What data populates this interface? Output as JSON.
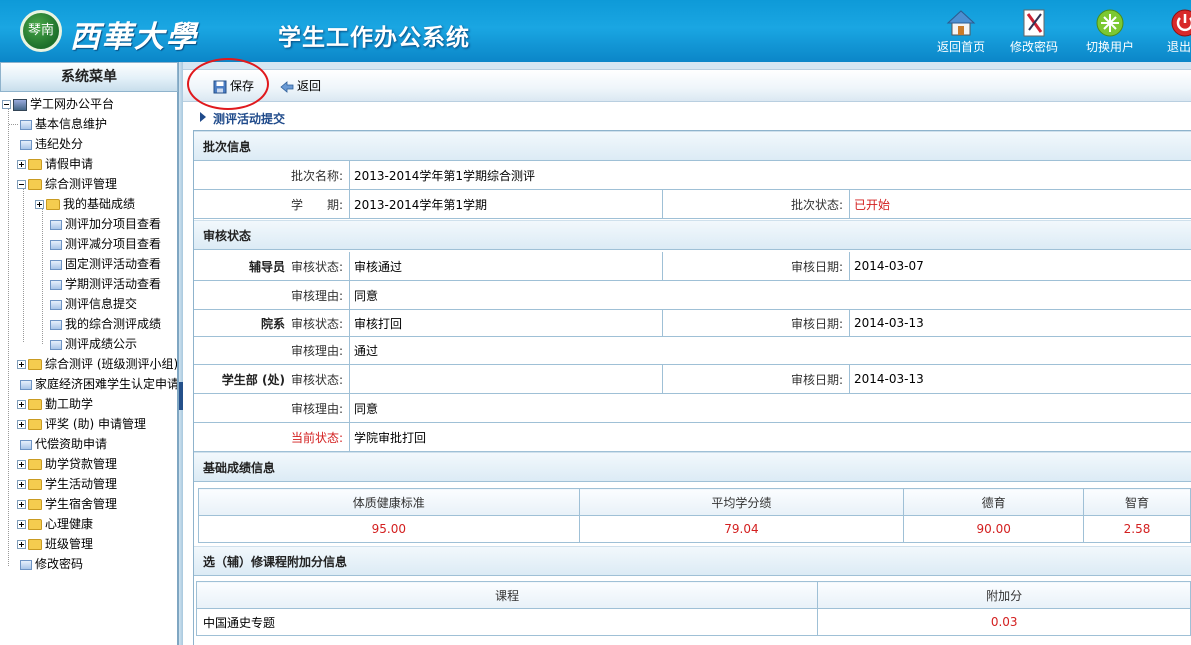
{
  "header": {
    "logo_text": "琴南",
    "university": "西華大學",
    "system_title": "学生工作办公系统",
    "buttons": [
      {
        "label": "返回首页",
        "icon": "home-icon"
      },
      {
        "label": "修改密码",
        "icon": "edit-password-icon"
      },
      {
        "label": "切换用户",
        "icon": "switch-user-icon"
      },
      {
        "label": "退出系",
        "icon": "power-icon"
      }
    ]
  },
  "sidebar": {
    "title": "系统菜单",
    "root": "学工网办公平台",
    "items": [
      {
        "label": "基本信息维护"
      },
      {
        "label": "违纪处分"
      },
      {
        "label": "请假申请"
      },
      {
        "label": "综合测评管理"
      },
      {
        "label": "我的基础成绩"
      },
      {
        "label": "测评加分项目查看"
      },
      {
        "label": "测评减分项目查看"
      },
      {
        "label": "固定测评活动查看"
      },
      {
        "label": "学期测评活动查看"
      },
      {
        "label": "测评信息提交"
      },
      {
        "label": "我的综合测评成绩"
      },
      {
        "label": "测评成绩公示"
      },
      {
        "label": "综合测评 (班级测评小组)"
      },
      {
        "label": "家庭经济困难学生认定申请"
      },
      {
        "label": "勤工助学"
      },
      {
        "label": "评奖 (助) 申请管理"
      },
      {
        "label": "代偿资助申请"
      },
      {
        "label": "助学贷款管理"
      },
      {
        "label": "学生活动管理"
      },
      {
        "label": "学生宿舍管理"
      },
      {
        "label": "心理健康"
      },
      {
        "label": "班级管理"
      },
      {
        "label": "修改密码"
      }
    ]
  },
  "toolbar": {
    "save_label": "保存",
    "back_label": "返回"
  },
  "page": {
    "section_title": "测评活动提交",
    "batch": {
      "heading": "批次信息",
      "name_label": "批次名称:",
      "name_value": "2013-2014学年第1学期综合测评",
      "term_label": "学　　期:",
      "term_value": "2013-2014学年第1学期",
      "status_label": "批次状态:",
      "status_value": "已开始"
    },
    "review": {
      "heading": "审核状态",
      "status_label": "审核状态:",
      "date_label": "审核日期:",
      "reason_label": "审核理由:",
      "counselor": {
        "role": "辅导员",
        "status": "审核通过",
        "date": "2014-03-07",
        "reason": "同意"
      },
      "department": {
        "role": "院系",
        "status": "审核打回",
        "date": "2014-03-13",
        "reason": "通过"
      },
      "student_office": {
        "role": "学生部 (处)",
        "status": "",
        "date": "2014-03-13",
        "reason": "同意"
      },
      "current_label": "当前状态:",
      "current_value": "学院审批打回"
    },
    "scores": {
      "heading": "基础成绩信息",
      "columns": [
        "体质健康标准",
        "平均学分绩",
        "德育",
        "智育"
      ],
      "values": [
        "95.00",
        "79.04",
        "90.00",
        "2.58"
      ]
    },
    "courses": {
      "heading": "选（辅）修课程附加分信息",
      "columns": [
        "课程",
        "附加分"
      ],
      "rows": [
        [
          "中国通史专题",
          "0.03"
        ]
      ]
    }
  },
  "colors": {
    "accent": "#1aa6e2",
    "status_red": "#d31f1f",
    "border": "#9fc0d6"
  }
}
